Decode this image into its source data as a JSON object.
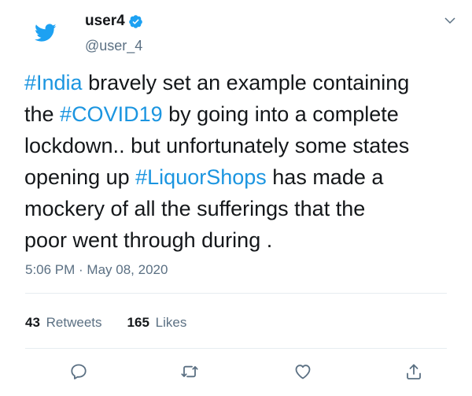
{
  "user": {
    "name": "user4",
    "handle": "@user_4"
  },
  "tweet": {
    "lines": [
      [
        {
          "t": "#India",
          "h": true
        },
        {
          "t": " bravely set an example containing",
          "h": false
        }
      ],
      [
        {
          "t": "the ",
          "h": false
        },
        {
          "t": "#COVID19",
          "h": true
        },
        {
          "t": " by going into a complete",
          "h": false
        }
      ],
      [
        {
          "t": "lockdown.. but unfortunately some states",
          "h": false
        }
      ],
      [
        {
          "t": "opening up ",
          "h": false
        },
        {
          "t": "#LiquorShops",
          "h": true
        },
        {
          "t": " has made a",
          "h": false
        }
      ],
      [
        {
          "t": "mockery of all the sufferings that the",
          "h": false
        }
      ],
      [
        {
          "t": "poor went through during  .",
          "h": false
        }
      ]
    ],
    "timestamp": "5:06 PM · May 08, 2020"
  },
  "stats": {
    "retweets_count": "43",
    "retweets_label": "Retweets",
    "likes_count": "165",
    "likes_label": "Likes"
  },
  "icons": {
    "avatar": "twitter-bird-icon",
    "verified": "verified-badge-icon",
    "caret": "chevron-down-icon",
    "reply": "reply-icon",
    "retweet": "retweet-icon",
    "like": "heart-icon",
    "share": "share-icon"
  },
  "colors": {
    "accent": "#1da1f2",
    "hashtag": "#1b95e0",
    "secondary_text": "#5b7083",
    "primary_text": "#14171a"
  }
}
